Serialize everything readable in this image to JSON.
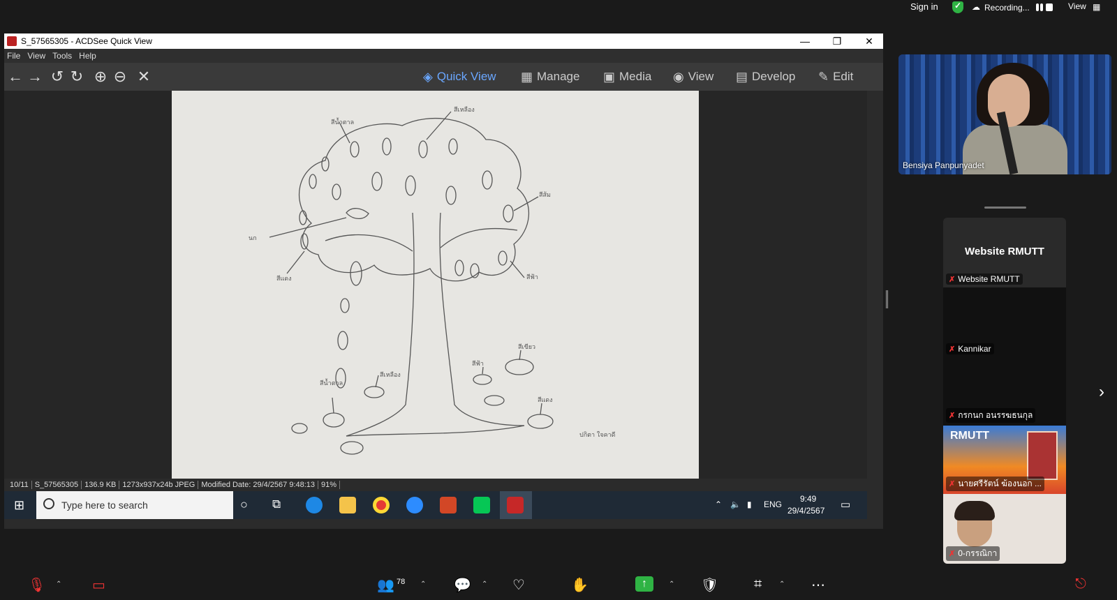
{
  "zoom_top": {
    "sign_in": "Sign in",
    "recording": "Recording...",
    "view": "View"
  },
  "acdsee": {
    "title": "S_57565305 - ACDSee Quick View",
    "menu": [
      "File",
      "View",
      "Tools",
      "Help"
    ],
    "modes": [
      "Quick View",
      "Manage",
      "Media",
      "View",
      "Develop",
      "Edit"
    ],
    "status": {
      "index": "10/11",
      "filename": "S_57565305",
      "size": "136.9 KB",
      "dims": "1273x937x24b JPEG",
      "modified": "Modified Date: 29/4/2567 9:48:13",
      "zoom": "91%"
    }
  },
  "taskbar": {
    "search_placeholder": "Type here to search",
    "lang": "ENG",
    "time": "9:49",
    "date": "29/4/2567"
  },
  "participants": {
    "main_name": "Bensiya Panpunyadet",
    "tiles": [
      {
        "big_name": "Website RMUTT",
        "label": "Website RMUTT"
      },
      {
        "label": "Kannikar"
      },
      {
        "label": "กรกนก อนรรฆธนกุล"
      },
      {
        "label": "นายศรีรัตน์ ฆ้องนอก ..."
      },
      {
        "label": "0-กรรณิกา"
      }
    ]
  },
  "zoom_bottom": {
    "participant_count": "78"
  },
  "colors": {
    "accent": "#6aa7ff",
    "zoom_green": "#2fb344"
  }
}
